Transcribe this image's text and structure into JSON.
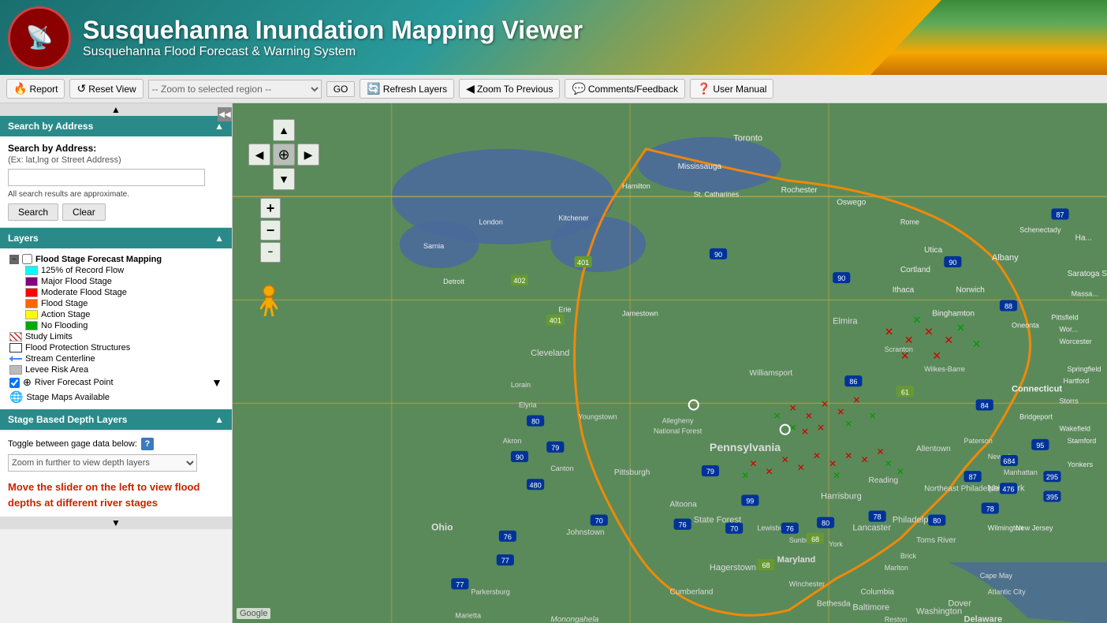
{
  "header": {
    "title": "Susquehanna Inundation Mapping Viewer",
    "subtitle": "Susquehanna Flood Forecast & Warning System",
    "logo_icon": "📡"
  },
  "toolbar": {
    "report_label": "Report",
    "reset_view_label": "Reset View",
    "zoom_placeholder": "-- Zoom to selected region --",
    "go_label": "GO",
    "refresh_label": "Refresh Layers",
    "zoom_prev_label": "Zoom To Previous",
    "comments_label": "Comments/Feedback",
    "manual_label": "User Manual"
  },
  "sidebar": {
    "search_section_title": "Search by Address",
    "search_label": "Search by Address:",
    "search_sub_label": "(Ex: lat,lng or Street Address)",
    "search_note": "All search results are approximate.",
    "search_btn": "Search",
    "clear_btn": "Clear",
    "layers_title": "Layers",
    "layers": [
      {
        "id": "flood-forecast",
        "label": "Flood Stage Forecast Mapping",
        "type": "group",
        "checked": false
      },
      {
        "id": "125-record",
        "label": "125% of Record Flow",
        "color": "#00ffff",
        "type": "legend"
      },
      {
        "id": "major-flood",
        "label": "Major Flood Stage",
        "color": "#800080",
        "type": "legend"
      },
      {
        "id": "moderate-flood",
        "label": "Moderate Flood Stage",
        "color": "#ff0000",
        "type": "legend"
      },
      {
        "id": "flood-stage",
        "label": "Flood Stage",
        "color": "#ff6600",
        "type": "legend"
      },
      {
        "id": "action-stage",
        "label": "Action Stage",
        "color": "#ffff00",
        "type": "legend"
      },
      {
        "id": "no-flooding",
        "label": "No Flooding",
        "color": "#00aa00",
        "type": "legend"
      },
      {
        "id": "study-limits",
        "label": "Study Limits",
        "type": "diagonal",
        "checked": false
      },
      {
        "id": "flood-protection",
        "label": "Flood Protection Structures",
        "type": "box",
        "checked": false
      },
      {
        "id": "stream-centerline",
        "label": "Stream Centerline",
        "type": "stream",
        "checked": false
      },
      {
        "id": "levee-risk",
        "label": "Levee Risk Area",
        "type": "swatch-levee",
        "checked": false
      },
      {
        "id": "river-forecast",
        "label": "River Forecast Point",
        "type": "checkbox",
        "checked": true
      },
      {
        "id": "stage-maps",
        "label": "Stage Maps Available",
        "type": "globe",
        "checked": false
      }
    ],
    "stage_section_title": "Stage Based Depth Layers",
    "toggle_label": "Toggle between gage data below:",
    "zoom_depth_placeholder": "Zoom in further to view depth layers",
    "slider_instruction": "Move the slider on the left to view flood depths at different river stages"
  },
  "map": {
    "google_label": "Google"
  }
}
